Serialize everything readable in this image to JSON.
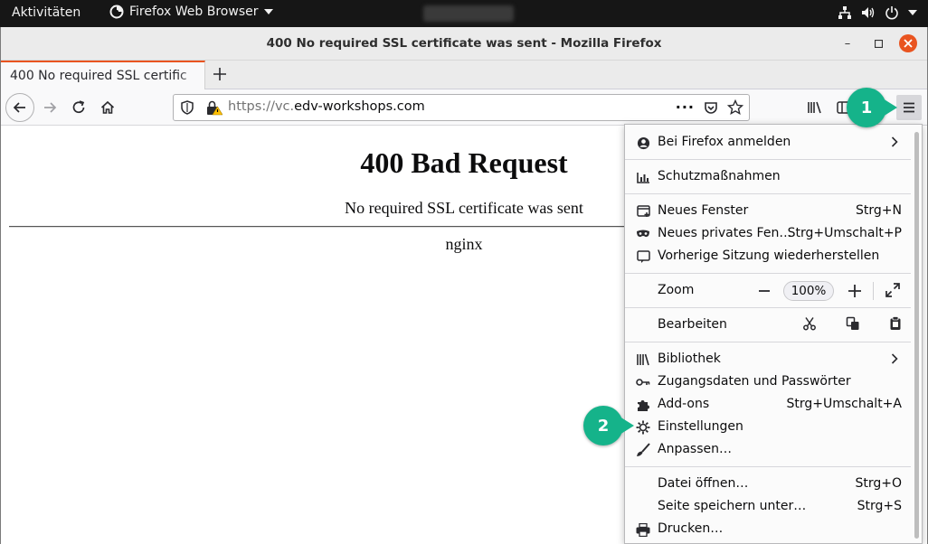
{
  "topbar": {
    "activities": "Aktivitäten",
    "app_name": "Firefox Web Browser"
  },
  "window": {
    "title": "400 No required SSL certificate was sent - Mozilla Firefox"
  },
  "tab": {
    "title": "400 No required SSL certific"
  },
  "urlbar": {
    "url_prefix": "https://vc.",
    "url_domain": "edv-workshops.com"
  },
  "page": {
    "heading": "400 Bad Request",
    "message": "No required SSL certificate was sent",
    "server": "nginx"
  },
  "menu": {
    "sign_in": "Bei Firefox anmelden",
    "protections": "Schutzmaßnahmen",
    "new_window": "Neues Fenster",
    "new_window_key": "Strg+N",
    "private_window": "Neues privates Fen…",
    "private_window_key": "Strg+Umschalt+P",
    "restore_session": "Vorherige Sitzung wiederherstellen",
    "zoom": "Zoom",
    "zoom_value": "100%",
    "edit": "Bearbeiten",
    "library": "Bibliothek",
    "logins": "Zugangsdaten und Passwörter",
    "addons": "Add-ons",
    "addons_key": "Strg+Umschalt+A",
    "settings": "Einstellungen",
    "customize": "Anpassen…",
    "open_file": "Datei öffnen…",
    "open_file_key": "Strg+O",
    "save_page": "Seite speichern unter…",
    "save_page_key": "Strg+S",
    "print": "Drucken…"
  },
  "badges": {
    "step1": "1",
    "step2": "2"
  },
  "colors": {
    "accent_orange": "#e95420",
    "badge_green": "#15b38a"
  }
}
